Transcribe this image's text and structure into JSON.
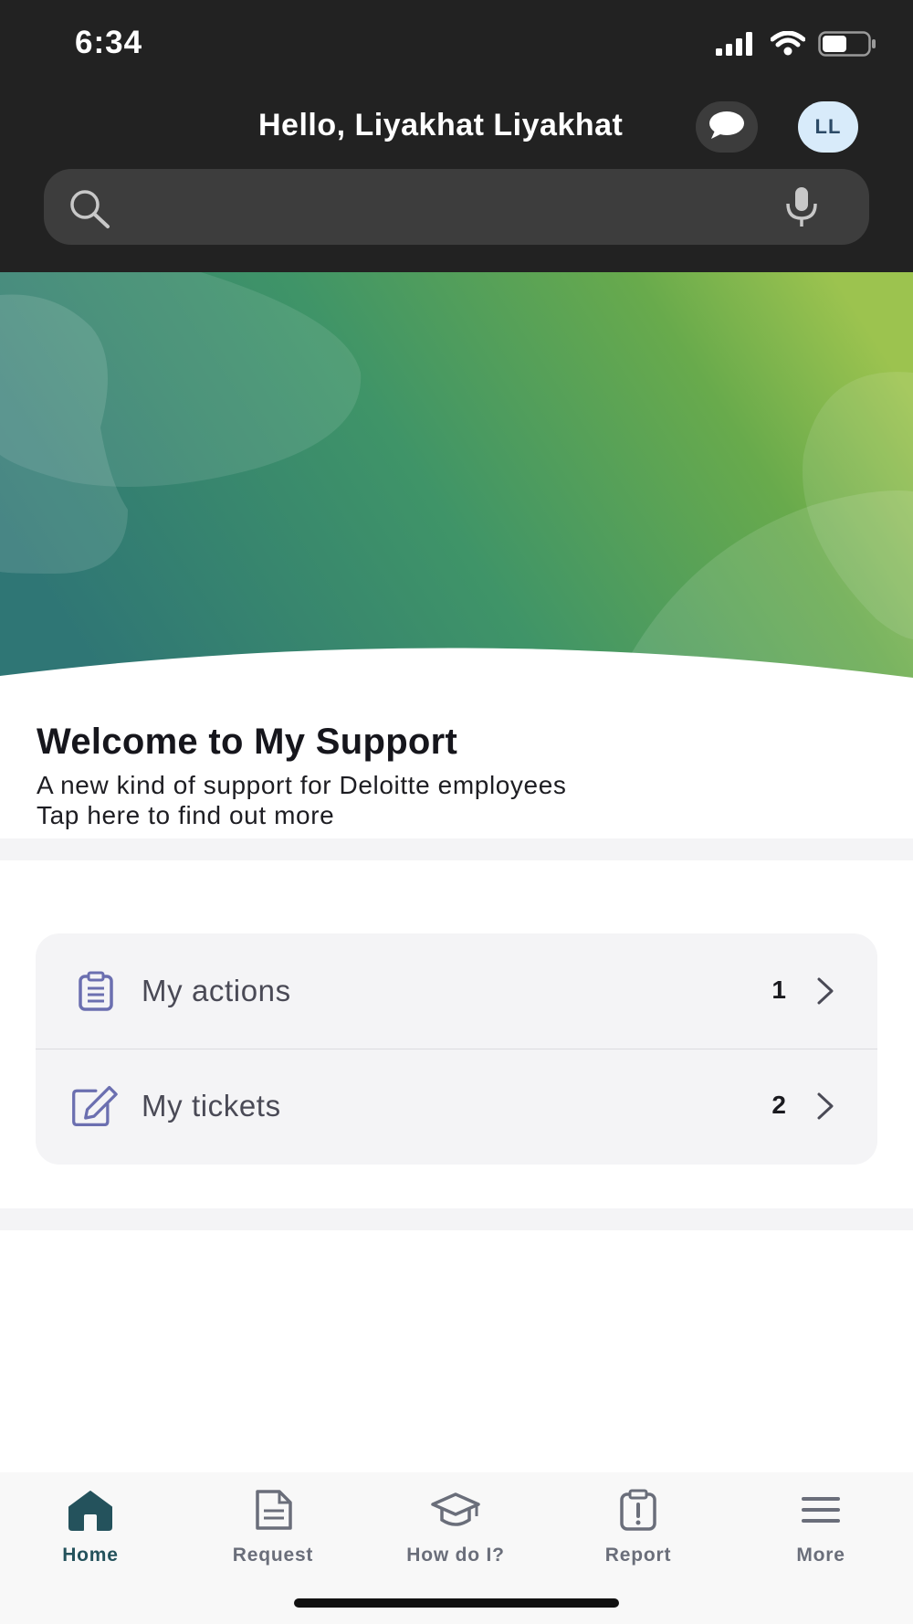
{
  "status_bar": {
    "time": "6:34"
  },
  "header": {
    "greeting": "Hello, Liyakhat Liyakhat",
    "avatar_initials": "LL",
    "chat_icon": "chat-bubble-icon"
  },
  "search": {
    "value": "",
    "placeholder": ""
  },
  "welcome": {
    "title": "Welcome to My Support",
    "line1": "A new kind of support for Deloitte employees",
    "line2": "Tap here to find out more"
  },
  "cards": [
    {
      "label": "My actions",
      "count": "1",
      "icon": "clipboard-list-icon"
    },
    {
      "label": "My tickets",
      "count": "2",
      "icon": "edit-pencil-icon"
    }
  ],
  "nav": [
    {
      "label": "Home",
      "icon": "home-icon",
      "active": true
    },
    {
      "label": "Request",
      "icon": "document-icon",
      "active": false
    },
    {
      "label": "How do I?",
      "icon": "graduation-cap-icon",
      "active": false
    },
    {
      "label": "Report",
      "icon": "clipboard-alert-icon",
      "active": false
    },
    {
      "label": "More",
      "icon": "menu-icon",
      "active": false
    }
  ],
  "colors": {
    "header_bg": "#222222",
    "accent_icon": "#6b6fb0",
    "nav_active": "#24525c",
    "nav_inactive": "#6a6e7a",
    "hero_gradient_start": "#2f7675",
    "hero_gradient_end": "#9cc34f"
  }
}
